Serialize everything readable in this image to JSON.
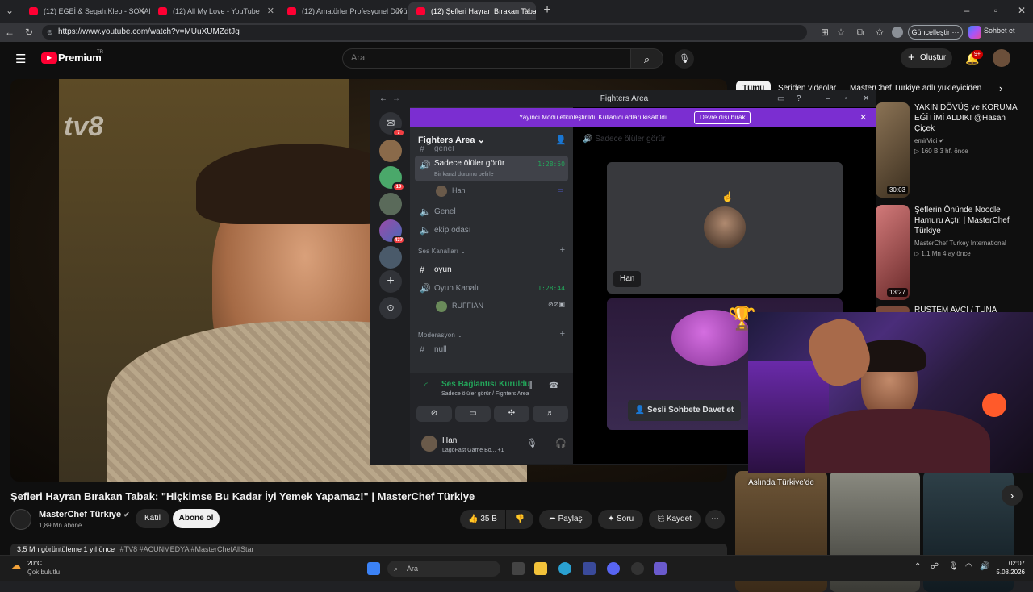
{
  "browser": {
    "tabs": [
      {
        "title": "(12) EGEİ & Segah,Kleo - SOKAKL..."
      },
      {
        "title": "(12) All My Love - YouTube"
      },
      {
        "title": "(12) Amatörler Profesyonel Dövüş"
      },
      {
        "title": "(12) Şefleri Hayran Bırakan Tabak:"
      }
    ],
    "url": "https://www.youtube.com/watch?v=MUuXUMZdtJg",
    "update_label": "Güncelleştir",
    "chat_label": "Sohbet et"
  },
  "youtube": {
    "logo": "Premium",
    "logo_region": "TR",
    "search_placeholder": "Ara",
    "create_label": "Oluştur",
    "notif_count": "9+",
    "channel_logo": "tv8",
    "video_title": "Şefleri Hayran Bırakan Tabak: \"Hiçkimse Bu Kadar İyi Yemek Yapamaz!\" | MasterChef Türkiye",
    "channel_name": "MasterChef Türkiye",
    "subscribers": "1,89 Mn abone",
    "join_label": "Katıl",
    "subscribe_label": "Abone ol",
    "likes": "35 B",
    "share_label": "Paylaş",
    "ask_label": "Soru",
    "save_label": "Kaydet",
    "description": "3,5 Mn görüntüleme  1 yıl önce",
    "hashtags": "#TV8 #ACUNMEDYA #MasterChefAllStar",
    "chips": [
      "Tümü",
      "Seriden videolar",
      "MasterChef Türkiye adlı yükleyiciden"
    ],
    "related": [
      {
        "title": "YAKIN DÖVÜŞ ve KORUMA EĞİTİMİ ALDIK! @Hasan Çiçek",
        "channel": "emirVici",
        "meta": "160 B  3 hf. önce",
        "duration": "30:03"
      },
      {
        "title": "Şeflerin Önünde Noodle Hamuru Açtı! | MasterChef Türkiye",
        "channel": "MasterChef Turkey International",
        "meta": "1,1 Mn  4 ay önce",
        "duration": "13:27"
      },
      {
        "title": "RÜSTEM AVCI / TUNA NEHRİ"
      }
    ],
    "shorts_caption": "Aslında Türkiye'de"
  },
  "discord": {
    "window_title": "Fighters Area",
    "banner_text": "Yayıncı Modu etkinleştirildi. Kullanıcı adları kısaltıldı.",
    "banner_button": "Devre dışı bırak",
    "server_name": "Fighters Area",
    "server_badges": [
      "7",
      "10",
      "437"
    ],
    "partial_channel": "genel",
    "active_channel": "Sadece ölüler görür",
    "active_channel_time": "1:28:50",
    "channel_status": "Bir kanal durumu belirle",
    "member1": "Han",
    "channel_genel": "Genel",
    "channel_ekip": "ekip odası",
    "cat_ses": "Ses Kanalları",
    "channel_oyun": "oyun",
    "channel_oyunkanali": "Oyun Kanalı",
    "oyun_time": "1:28:44",
    "member2": "RUFFIAN",
    "cat_mod": "Moderasyon",
    "channel_null": "null",
    "voice_status": "Ses Bağlantısı Kuruldu",
    "voice_location": "Sadece ölüler görür / Fighters Area",
    "user_name": "Han",
    "user_activity": "LagoFast Game Bo...",
    "user_activity_extra": "+1",
    "stage_header": "Sadece ölüler görür",
    "tile_name": "Han",
    "invite_label": "Sesli Sohbete Davet et"
  },
  "taskbar": {
    "temperature": "20°C",
    "weather": "Çok bulutlu",
    "search": "Ara",
    "time": "02:07",
    "date": "5.08.2026"
  }
}
